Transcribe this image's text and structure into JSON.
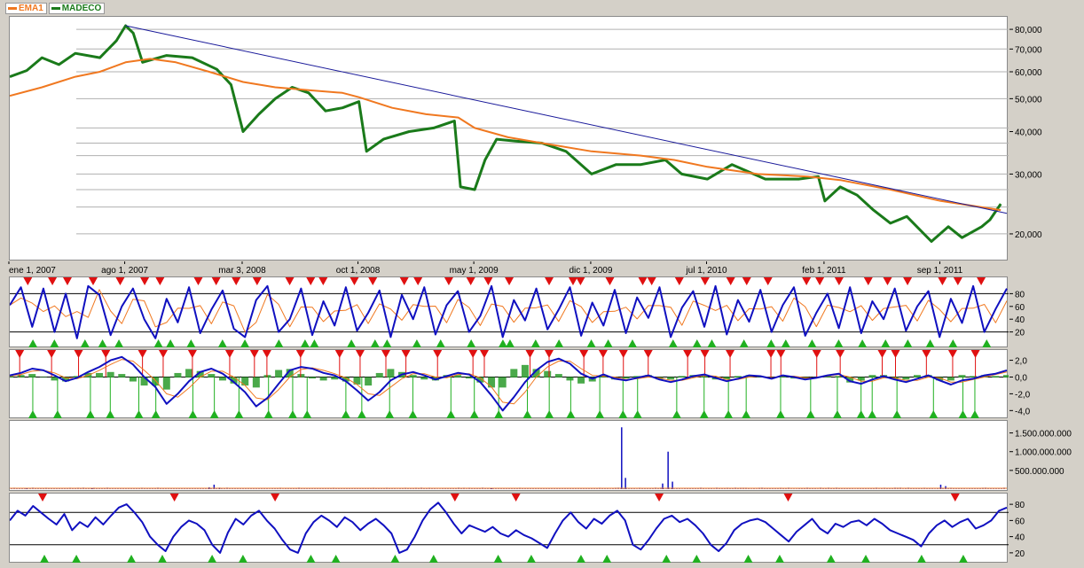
{
  "colors": {
    "ema": "#f07820",
    "price": "#1a7a1a",
    "trend": "#1a1a9a",
    "osc": "#1010c0",
    "sell": "#e01010",
    "buy": "#20b020",
    "ref": "#000000",
    "grid": "#b0b0b0",
    "hist": "#2a9a2a"
  },
  "legend": [
    {
      "label": "EMA1",
      "color": "#f07820"
    },
    {
      "label": "MADECO",
      "color": "#1a7a1a"
    }
  ],
  "x_axis": {
    "tick_labels": [
      "ene 1, 2007",
      "ago 1, 2007",
      "mar 3, 2008",
      "oct 1, 2008",
      "may 1, 2009",
      "dic 1, 2009",
      "jul 1, 2010",
      "feb 1, 2011",
      "sep 1, 2011"
    ]
  },
  "chart_data": [
    {
      "type": "line",
      "title": "",
      "scale": "log",
      "ylim": [
        17000,
        85000
      ],
      "y_tick_labels": [
        "80,000",
        "70,000",
        "60,000",
        "50,000",
        "40,000",
        "30,000",
        "20,000"
      ],
      "x_range": [
        "2007-01-01",
        "2011-12-31"
      ],
      "series": [
        {
          "name": "MADECO",
          "color": "#1a7a1a",
          "points": [
            [
              "2007-01-01",
              58000
            ],
            [
              "2007-02-01",
              60500
            ],
            [
              "2007-03-01",
              66000
            ],
            [
              "2007-04-01",
              63000
            ],
            [
              "2007-05-01",
              68000
            ],
            [
              "2007-06-15",
              66000
            ],
            [
              "2007-07-15",
              74000
            ],
            [
              "2007-08-01",
              82000
            ],
            [
              "2007-08-15",
              78000
            ],
            [
              "2007-09-01",
              64000
            ],
            [
              "2007-10-15",
              67000
            ],
            [
              "2007-12-01",
              66000
            ],
            [
              "2008-01-15",
              61000
            ],
            [
              "2008-02-10",
              55000
            ],
            [
              "2008-03-03",
              40000
            ],
            [
              "2008-04-01",
              45000
            ],
            [
              "2008-05-01",
              50000
            ],
            [
              "2008-06-01",
              54000
            ],
            [
              "2008-07-01",
              52000
            ],
            [
              "2008-08-01",
              46000
            ],
            [
              "2008-09-01",
              47000
            ],
            [
              "2008-10-01",
              49000
            ],
            [
              "2008-10-15",
              35000
            ],
            [
              "2008-11-15",
              38000
            ],
            [
              "2009-01-01",
              40000
            ],
            [
              "2009-02-15",
              41000
            ],
            [
              "2009-03-25",
              43000
            ],
            [
              "2009-04-05",
              27500
            ],
            [
              "2009-05-01",
              27000
            ],
            [
              "2009-05-20",
              33000
            ],
            [
              "2009-06-10",
              38000
            ],
            [
              "2009-07-15",
              37500
            ],
            [
              "2009-09-01",
              37000
            ],
            [
              "2009-10-15",
              35000
            ],
            [
              "2009-12-01",
              30000
            ],
            [
              "2010-01-15",
              32000
            ],
            [
              "2010-03-01",
              32000
            ],
            [
              "2010-04-15",
              33000
            ],
            [
              "2010-05-15",
              30000
            ],
            [
              "2010-07-01",
              29000
            ],
            [
              "2010-08-15",
              32000
            ],
            [
              "2010-10-15",
              29000
            ],
            [
              "2010-12-15",
              29000
            ],
            [
              "2011-01-20",
              29500
            ],
            [
              "2011-02-01",
              25000
            ],
            [
              "2011-03-01",
              27500
            ],
            [
              "2011-04-01",
              26000
            ],
            [
              "2011-05-01",
              23500
            ],
            [
              "2011-06-01",
              21500
            ],
            [
              "2011-07-01",
              22500
            ],
            [
              "2011-08-15",
              19000
            ],
            [
              "2011-09-15",
              21000
            ],
            [
              "2011-10-10",
              19500
            ],
            [
              "2011-11-15",
              21000
            ],
            [
              "2011-11-30",
              22000
            ],
            [
              "2011-12-20",
              24500
            ]
          ]
        },
        {
          "name": "EMA1",
          "color": "#f07820",
          "points": [
            [
              "2007-01-01",
              51000
            ],
            [
              "2007-03-01",
              54000
            ],
            [
              "2007-05-01",
              58000
            ],
            [
              "2007-06-15",
              60000
            ],
            [
              "2007-08-01",
              64000
            ],
            [
              "2007-09-15",
              65500
            ],
            [
              "2007-11-01",
              64000
            ],
            [
              "2008-01-01",
              60000
            ],
            [
              "2008-03-03",
              56000
            ],
            [
              "2008-05-01",
              54000
            ],
            [
              "2008-07-01",
              53000
            ],
            [
              "2008-09-01",
              52000
            ],
            [
              "2008-10-01",
              50500
            ],
            [
              "2008-12-01",
              47000
            ],
            [
              "2009-02-01",
              45000
            ],
            [
              "2009-04-01",
              44000
            ],
            [
              "2009-05-01",
              41000
            ],
            [
              "2009-07-01",
              38500
            ],
            [
              "2009-09-01",
              37000
            ],
            [
              "2009-12-01",
              35000
            ],
            [
              "2010-03-01",
              34000
            ],
            [
              "2010-05-01",
              33000
            ],
            [
              "2010-07-01",
              31500
            ],
            [
              "2010-10-01",
              30000
            ],
            [
              "2011-01-01",
              29500
            ],
            [
              "2011-03-01",
              28800
            ],
            [
              "2011-06-01",
              27000
            ],
            [
              "2011-09-01",
              25000
            ],
            [
              "2011-12-20",
              23500
            ]
          ]
        },
        {
          "name": "trend",
          "color": "#1a1a9a",
          "points": [
            [
              "2007-08-01",
              82000
            ],
            [
              "2011-12-31",
              23000
            ]
          ]
        }
      ]
    },
    {
      "type": "line",
      "title": "",
      "ylim": [
        0,
        100
      ],
      "y_tick_labels": [
        "80",
        "60",
        "40",
        "20"
      ],
      "reference_lines": [
        80,
        20
      ],
      "series": [
        {
          "name": "",
          "color": "#1010c0",
          "values": [
            62,
            90,
            28,
            88,
            20,
            80,
            10,
            92,
            78,
            15,
            60,
            88,
            40,
            10,
            72,
            35,
            90,
            18,
            55,
            85,
            25,
            12,
            70,
            92,
            20,
            40,
            88,
            15,
            68,
            30,
            90,
            22,
            50,
            85,
            12,
            78,
            40,
            90,
            16,
            62,
            84,
            20,
            45,
            92,
            12,
            70,
            38,
            88,
            24,
            55,
            90,
            14,
            66,
            30,
            86,
            18,
            74,
            42,
            90,
            12,
            58,
            84,
            28,
            92,
            16,
            70,
            36,
            86,
            20,
            62,
            90,
            14,
            50,
            80,
            26,
            90,
            18,
            68,
            40,
            88,
            22,
            60,
            84,
            12,
            72,
            34,
            92,
            20,
            56,
            88
          ]
        }
      ],
      "markers": {
        "sell": 42,
        "buy": 40
      }
    },
    {
      "type": "line",
      "title": "",
      "ylim": [
        -4.6,
        2.8
      ],
      "y_tick_labels": [
        "2,0",
        "0,0",
        "-2,0",
        "-4,0"
      ],
      "series": [
        {
          "name": "",
          "color": "#1010c0",
          "values": [
            0.2,
            0.5,
            1.0,
            0.8,
            0.2,
            -0.5,
            -0.1,
            0.6,
            1.2,
            2.0,
            2.4,
            1.5,
            0.0,
            -1.2,
            -3.2,
            -2.0,
            -0.5,
            0.6,
            1.0,
            0.4,
            -0.6,
            -1.8,
            -3.5,
            -2.5,
            -0.8,
            0.8,
            1.2,
            1.0,
            0.5,
            0.2,
            -0.5,
            -1.6,
            -2.8,
            -1.8,
            -0.4,
            0.3,
            0.6,
            0.2,
            -0.3,
            0.1,
            0.5,
            0.3,
            -0.6,
            -2.2,
            -4.0,
            -2.4,
            -0.6,
            0.8,
            1.8,
            2.2,
            1.6,
            0.4,
            -0.2,
            0.3,
            -0.2,
            -0.4,
            -0.1,
            0.2,
            -0.3,
            -0.6,
            -0.3,
            0.1,
            0.3,
            -0.1,
            -0.5,
            -0.2,
            0.2,
            0.1,
            -0.2,
            0.2,
            0.0,
            -0.3,
            -0.1,
            0.2,
            0.4,
            -0.5,
            -0.8,
            -0.3,
            0.1,
            -0.3,
            -0.6,
            -0.2,
            0.2,
            -0.4,
            -0.9,
            -0.4,
            -0.2,
            0.2,
            0.4,
            0.8
          ]
        },
        {
          "name": "",
          "color": "#f07820",
          "values": [
            0.1,
            0.3,
            0.7,
            0.8,
            0.5,
            -0.1,
            -0.2,
            0.2,
            0.8,
            1.5,
            2.1,
            1.9,
            0.8,
            -0.4,
            -2.0,
            -2.4,
            -1.3,
            0.0,
            0.7,
            0.7,
            0.0,
            -1.0,
            -2.5,
            -2.7,
            -1.5,
            0.0,
            0.9,
            1.1,
            0.8,
            0.4,
            -0.1,
            -0.9,
            -2.0,
            -2.2,
            -1.2,
            -0.2,
            0.4,
            0.4,
            0.0,
            -0.1,
            0.3,
            0.4,
            -0.1,
            -1.2,
            -3.0,
            -3.2,
            -1.8,
            0.0,
            1.2,
            1.9,
            1.9,
            1.0,
            0.2,
            0.1,
            0.0,
            -0.3,
            -0.2,
            0.0,
            -0.1,
            -0.4,
            -0.4,
            -0.1,
            0.2,
            0.1,
            -0.3,
            -0.3,
            0.0,
            0.1,
            -0.1,
            0.1,
            0.1,
            -0.1,
            -0.1,
            0.1,
            0.3,
            0.0,
            -0.5,
            -0.5,
            -0.1,
            -0.1,
            -0.4,
            -0.4,
            0.0,
            -0.1,
            -0.6,
            -0.6,
            -0.3,
            0.0,
            0.3,
            0.6
          ]
        }
      ],
      "markers": {
        "sell": 36,
        "buy": 38
      }
    },
    {
      "type": "bar",
      "title": "",
      "ylim": [
        0,
        1750000000
      ],
      "y_tick_labels": [
        "1.500.000.000",
        "1.000.000.000",
        "500.000.000"
      ],
      "spikes": [
        [
          "2007-02-01",
          15000000
        ],
        [
          "2007-06-01",
          20000000
        ],
        [
          "2008-01-01",
          50000000
        ],
        [
          "2008-01-10",
          120000000
        ],
        [
          "2008-01-20",
          40000000
        ],
        [
          "2009-06-01",
          30000000
        ],
        [
          "2010-01-25",
          1650000000
        ],
        [
          "2010-02-01",
          300000000
        ],
        [
          "2010-04-10",
          150000000
        ],
        [
          "2010-04-20",
          1000000000
        ],
        [
          "2010-04-28",
          200000000
        ],
        [
          "2011-09-01",
          120000000
        ],
        [
          "2011-09-10",
          80000000
        ]
      ],
      "baseline": 25000000
    },
    {
      "type": "line",
      "title": "",
      "ylim": [
        10,
        90
      ],
      "y_tick_labels": [
        "80",
        "60",
        "40",
        "20"
      ],
      "reference_lines": [
        70,
        30
      ],
      "series": [
        {
          "name": "",
          "color": "#1010c0",
          "values": [
            60,
            72,
            66,
            78,
            70,
            62,
            55,
            68,
            48,
            58,
            52,
            64,
            55,
            66,
            76,
            80,
            70,
            58,
            40,
            30,
            22,
            40,
            52,
            60,
            56,
            48,
            30,
            20,
            45,
            62,
            55,
            66,
            72,
            60,
            50,
            36,
            24,
            20,
            44,
            58,
            66,
            60,
            52,
            64,
            58,
            48,
            56,
            62,
            54,
            44,
            20,
            24,
            40,
            60,
            74,
            82,
            70,
            56,
            44,
            54,
            50,
            46,
            52,
            44,
            40,
            48,
            42,
            38,
            32,
            26,
            44,
            60,
            70,
            58,
            50,
            62,
            56,
            66,
            72,
            60,
            30,
            24,
            36,
            50,
            62,
            66,
            58,
            62,
            54,
            44,
            30,
            22,
            32,
            48,
            56,
            60,
            62,
            58,
            50,
            42,
            34,
            46,
            54,
            62,
            50,
            44,
            56,
            52,
            58,
            60,
            54,
            62,
            56,
            48,
            44,
            40,
            36,
            28,
            44,
            54,
            60,
            52,
            58,
            62,
            50,
            54,
            60,
            72,
            76
          ]
        }
      ],
      "markers": {
        "sell": 8,
        "buy": 22
      }
    }
  ]
}
